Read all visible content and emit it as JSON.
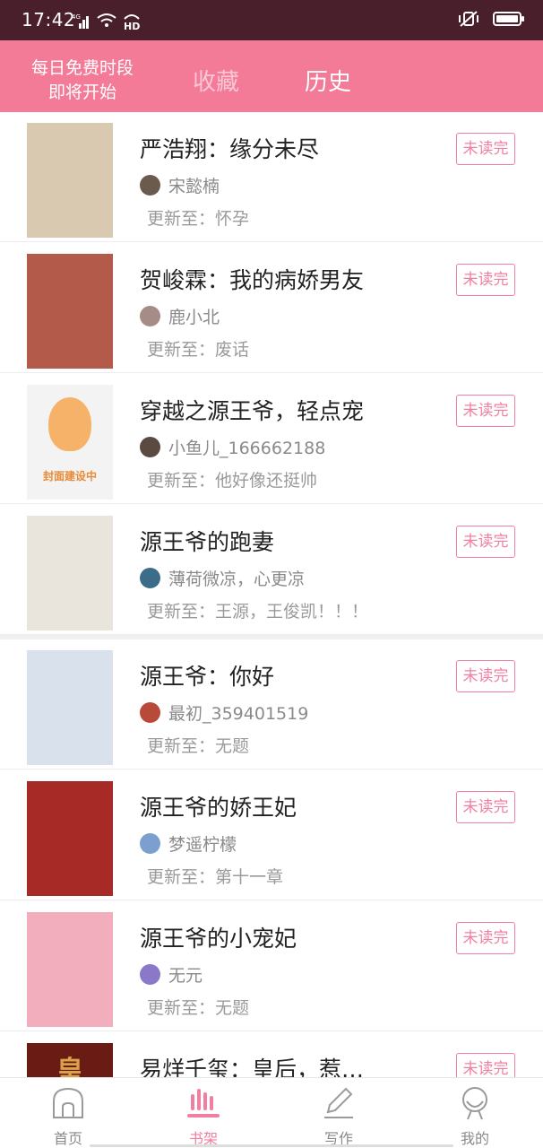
{
  "status": {
    "time": "17:42",
    "network": "4G",
    "hd": "HD"
  },
  "header": {
    "promo_line1": "每日免费时段",
    "promo_line2": "即将开始",
    "tabs": [
      {
        "label": "收藏",
        "active": false
      },
      {
        "label": "历史",
        "active": true
      }
    ]
  },
  "unread_label": "未读完",
  "books": [
    {
      "title": "严浩翔：缘分未尽",
      "author": "宋懿楠",
      "update": "更新至：怀孕",
      "cover_color": "#d8c9b0",
      "avatar_color": "#6b5a4e"
    },
    {
      "title": "贺峻霖：我的病娇男友",
      "author": "鹿小北",
      "update": "更新至：废话",
      "cover_color": "#b45a4a",
      "avatar_color": "#a68c87"
    },
    {
      "title": "穿越之源王爷，轻点宠",
      "author": "小鱼儿_166662188",
      "update": "更新至：他好像还挺帅",
      "cover_color": "#f3f3f3",
      "avatar_color": "#5a4a42",
      "cover_label": "封面建设中"
    },
    {
      "title": "源王爷的跑妻",
      "author": "薄荷微凉，心更凉",
      "update": "更新至：王源，王俊凯！！！",
      "cover_color": "#e9e5dc",
      "avatar_color": "#3b6c8a"
    },
    {
      "title": "源王爷：你好",
      "author": "最初_359401519",
      "update": "更新至：无题",
      "cover_color": "#d9e2ec",
      "avatar_color": "#b94a3a"
    },
    {
      "title": "源王爷的娇王妃",
      "author": "梦遥柠檬",
      "update": "更新至：第十一章",
      "cover_color": "#a82a26",
      "avatar_color": "#7b9fcf"
    },
    {
      "title": "源王爷的小宠妃",
      "author": "无元",
      "update": "更新至：无题",
      "cover_color": "#f2aebc",
      "avatar_color": "#8a78c8"
    },
    {
      "title": "易烊千玺：皇后，惹…",
      "author": "",
      "update": "",
      "cover_color": "#6a1c14",
      "avatar_color": "#999999",
      "cover_label": "皇"
    }
  ],
  "nav": [
    {
      "label": "首页",
      "icon": "home-icon",
      "active": false
    },
    {
      "label": "书架",
      "icon": "bookshelf-icon",
      "active": true
    },
    {
      "label": "写作",
      "icon": "pencil-icon",
      "active": false
    },
    {
      "label": "我的",
      "icon": "profile-icon",
      "active": false
    }
  ],
  "colors": {
    "accent": "#f37b98",
    "status_bar": "#4a1f2c",
    "unread": "#f07fa0"
  }
}
